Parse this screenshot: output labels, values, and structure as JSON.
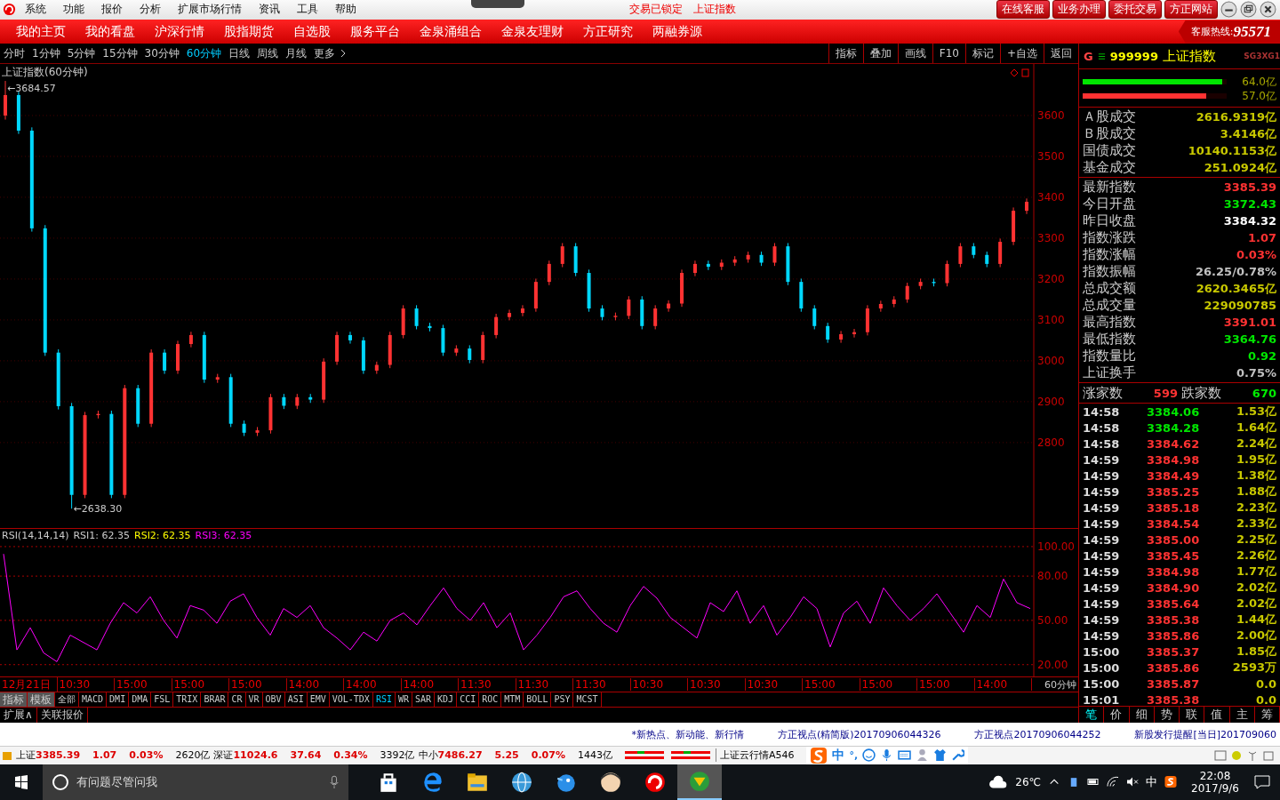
{
  "title_bar": {
    "menu": [
      "系统",
      "功能",
      "报价",
      "分析",
      "扩展市场行情",
      "资讯",
      "工具",
      "帮助"
    ],
    "status": "交易已锁定",
    "symbol": "上证指数",
    "buttons": [
      "在线客服",
      "业务办理",
      "委托交易",
      "方正网站"
    ]
  },
  "nav": {
    "items": [
      "我的主页",
      "我的看盘",
      "沪深行情",
      "股指期货",
      "自选股",
      "服务平台",
      "金泉涌组合",
      "金泉友理财",
      "方正研究",
      "两融券源"
    ],
    "hotline_label": "客服热线:",
    "hotline": "95571"
  },
  "periods": [
    {
      "label": "分时",
      "selected": false
    },
    {
      "label": "1分钟",
      "selected": false
    },
    {
      "label": "5分钟",
      "selected": false
    },
    {
      "label": "15分钟",
      "selected": false
    },
    {
      "label": "30分钟",
      "selected": false
    },
    {
      "label": "60分钟",
      "selected": true
    },
    {
      "label": "日线",
      "selected": false
    },
    {
      "label": "周线",
      "selected": false
    },
    {
      "label": "月线",
      "selected": false
    },
    {
      "label": "更多",
      "selected": false
    }
  ],
  "tools": [
    "指标",
    "叠加",
    "画线",
    "F10",
    "标记",
    "+自选",
    "返回"
  ],
  "price_chart": {
    "title": "上证指数(60分钟)",
    "chart_data": {
      "type": "candlestick",
      "grid": true,
      "ylim": [
        2591,
        3726
      ],
      "yticks": [
        2800,
        2900,
        3000,
        3100,
        3200,
        3300,
        3400,
        3500,
        3600
      ],
      "ohlc": [
        [
          3600,
          3684.57,
          3590,
          3650
        ],
        [
          3650,
          3658,
          3555,
          3563
        ],
        [
          3563,
          3571,
          3316,
          3324
        ],
        [
          3324,
          3332,
          3012,
          3020
        ],
        [
          3020,
          3028,
          2881,
          2889
        ],
        [
          2889,
          2897,
          2638.3,
          2672
        ],
        [
          2672,
          2875,
          2664,
          2867
        ],
        [
          2867,
          2878,
          2859,
          2870
        ],
        [
          2870,
          2878,
          2664,
          2672
        ],
        [
          2672,
          2941,
          2664,
          2933
        ],
        [
          2933,
          2941,
          2838,
          2846
        ],
        [
          2846,
          3028,
          2838,
          3020
        ],
        [
          3020,
          3028,
          2968,
          2976
        ],
        [
          2976,
          3049,
          2968,
          3041
        ],
        [
          3041,
          3071,
          3033,
          3063
        ],
        [
          3063,
          3071,
          2946,
          2954
        ],
        [
          2954,
          2968,
          2946,
          2960
        ],
        [
          2960,
          2968,
          2838,
          2846
        ],
        [
          2846,
          2854,
          2816,
          2824
        ],
        [
          2824,
          2838,
          2816,
          2830
        ],
        [
          2830,
          2919,
          2822,
          2911
        ],
        [
          2911,
          2919,
          2882,
          2890
        ],
        [
          2890,
          2919,
          2882,
          2911
        ],
        [
          2911,
          2919,
          2897,
          2905
        ],
        [
          2905,
          3006,
          2897,
          2998
        ],
        [
          2998,
          3071,
          2990,
          3063
        ],
        [
          3063,
          3071,
          3042,
          3050
        ],
        [
          3050,
          3058,
          2968,
          2976
        ],
        [
          2976,
          2998,
          2968,
          2990
        ],
        [
          2990,
          3071,
          2982,
          3063
        ],
        [
          3063,
          3136,
          3055,
          3128
        ],
        [
          3128,
          3136,
          3077,
          3085
        ],
        [
          3085,
          3093,
          3072,
          3080
        ],
        [
          3080,
          3088,
          3012,
          3020
        ],
        [
          3020,
          3038,
          3012,
          3030
        ],
        [
          3030,
          3038,
          2994,
          3002
        ],
        [
          3002,
          3071,
          2994,
          3063
        ],
        [
          3063,
          3115,
          3055,
          3107
        ],
        [
          3107,
          3125,
          3099,
          3117
        ],
        [
          3117,
          3136,
          3109,
          3128
        ],
        [
          3128,
          3201,
          3120,
          3193
        ],
        [
          3193,
          3245,
          3185,
          3237
        ],
        [
          3237,
          3288,
          3229,
          3280
        ],
        [
          3280,
          3288,
          3207,
          3215
        ],
        [
          3215,
          3223,
          3120,
          3128
        ],
        [
          3128,
          3136,
          3099,
          3107
        ],
        [
          3107,
          3118,
          3099,
          3110
        ],
        [
          3110,
          3158,
          3102,
          3150
        ],
        [
          3150,
          3158,
          3077,
          3085
        ],
        [
          3085,
          3136,
          3077,
          3128
        ],
        [
          3128,
          3148,
          3120,
          3140
        ],
        [
          3140,
          3223,
          3132,
          3215
        ],
        [
          3215,
          3245,
          3207,
          3237
        ],
        [
          3237,
          3245,
          3222,
          3230
        ],
        [
          3230,
          3248,
          3222,
          3240
        ],
        [
          3240,
          3256,
          3232,
          3248
        ],
        [
          3248,
          3267,
          3240,
          3259
        ],
        [
          3259,
          3267,
          3232,
          3240
        ],
        [
          3240,
          3288,
          3232,
          3280
        ],
        [
          3280,
          3288,
          3185,
          3193
        ],
        [
          3193,
          3201,
          3120,
          3128
        ],
        [
          3128,
          3136,
          3077,
          3085
        ],
        [
          3085,
          3093,
          3044,
          3052
        ],
        [
          3052,
          3073,
          3044,
          3065
        ],
        [
          3065,
          3078,
          3057,
          3070
        ],
        [
          3070,
          3136,
          3062,
          3128
        ],
        [
          3128,
          3147,
          3120,
          3139
        ],
        [
          3139,
          3158,
          3131,
          3150
        ],
        [
          3150,
          3191,
          3142,
          3183
        ],
        [
          3183,
          3201,
          3175,
          3193
        ],
        [
          3193,
          3201,
          3182,
          3190
        ],
        [
          3190,
          3245,
          3182,
          3237
        ],
        [
          3237,
          3288,
          3229,
          3280
        ],
        [
          3280,
          3288,
          3251,
          3259
        ],
        [
          3259,
          3267,
          3229,
          3237
        ],
        [
          3237,
          3299,
          3229,
          3291
        ],
        [
          3291,
          3375,
          3283,
          3367
        ],
        [
          3367,
          3397,
          3359,
          3389
        ]
      ],
      "annotations": [
        {
          "text": "←3684.57"
        },
        {
          "text": "←2638.30"
        }
      ]
    }
  },
  "rsi_chart": {
    "legend": [
      "RSI(14,14,14)",
      "RSI1: 62.35",
      "RSI2: 62.35",
      "RSI3: 62.35"
    ],
    "chart_data": {
      "type": "line",
      "grid": true,
      "ylim": [
        12,
        112
      ],
      "yticks": [
        {
          "value": 100,
          "label": "100.00"
        },
        {
          "value": 80,
          "label": "80.00"
        },
        {
          "value": 50,
          "label": "50.00"
        },
        {
          "value": 20,
          "label": "20.00"
        }
      ],
      "series": [
        {
          "color": "#ff00ff",
          "values": [
            95,
            30,
            45,
            28,
            22,
            40,
            35,
            30,
            48,
            62,
            55,
            66,
            50,
            38,
            60,
            57,
            48,
            63,
            68,
            52,
            40,
            58,
            52,
            60,
            45,
            38,
            30,
            42,
            36,
            50,
            55,
            47,
            60,
            72,
            58,
            50,
            62,
            45,
            55,
            30,
            40,
            52,
            66,
            70,
            58,
            48,
            42,
            60,
            73,
            65,
            52,
            45,
            38,
            62,
            56,
            70,
            48,
            60,
            40,
            52,
            66,
            58,
            32,
            55,
            63,
            48,
            72,
            60,
            50,
            58,
            68,
            55,
            42,
            60,
            52,
            78,
            62,
            58
          ]
        }
      ]
    }
  },
  "x_labels": [
    "12月21日",
    "10:30",
    "15:00",
    "15:00",
    "15:00",
    "14:00",
    "14:00",
    "14:00",
    "11:30",
    "11:30",
    "11:30",
    "10:30",
    "10:30",
    "10:30",
    "15:00",
    "15:00",
    "15:00",
    "14:00"
  ],
  "period_label": "60分钟",
  "indicator_tabs": [
    {
      "label": "指标",
      "selected": false,
      "kind": "tool"
    },
    {
      "label": "模板",
      "selected": false,
      "kind": "tool"
    },
    {
      "label": "全部",
      "selected": false,
      "kind": "tab"
    },
    {
      "label": "MACD",
      "selected": false,
      "kind": "tab"
    },
    {
      "label": "DMI",
      "selected": false,
      "kind": "tab"
    },
    {
      "label": "DMA",
      "selected": false,
      "kind": "tab"
    },
    {
      "label": "FSL",
      "selected": false,
      "kind": "tab"
    },
    {
      "label": "TRIX",
      "selected": false,
      "kind": "tab"
    },
    {
      "label": "BRAR",
      "selected": false,
      "kind": "tab"
    },
    {
      "label": "CR",
      "selected": false,
      "kind": "tab"
    },
    {
      "label": "VR",
      "selected": false,
      "kind": "tab"
    },
    {
      "label": "OBV",
      "selected": false,
      "kind": "tab"
    },
    {
      "label": "ASI",
      "selected": false,
      "kind": "tab"
    },
    {
      "label": "EMV",
      "selected": false,
      "kind": "tab"
    },
    {
      "label": "VOL-TDX",
      "selected": false,
      "kind": "tab"
    },
    {
      "label": "RSI",
      "selected": true,
      "kind": "tab"
    },
    {
      "label": "WR",
      "selected": false,
      "kind": "tab"
    },
    {
      "label": "SAR",
      "selected": false,
      "kind": "tab"
    },
    {
      "label": "KDJ",
      "selected": false,
      "kind": "tab"
    },
    {
      "label": "CCI",
      "selected": false,
      "kind": "tab"
    },
    {
      "label": "ROC",
      "selected": false,
      "kind": "tab"
    },
    {
      "label": "MTM",
      "selected": false,
      "kind": "tab"
    },
    {
      "label": "BOLL",
      "selected": false,
      "kind": "tab"
    },
    {
      "label": "PSY",
      "selected": false,
      "kind": "tab"
    },
    {
      "label": "MCST",
      "selected": false,
      "kind": "tab"
    }
  ],
  "bottom_tabs": [
    "扩展∧",
    "关联报价"
  ],
  "quote": {
    "market": "G",
    "code": "999999",
    "name": "上证指数",
    "extra": "SG3XG1",
    "bars": [
      {
        "level": 0.97,
        "value": "64.0亿",
        "color": "#00e600"
      },
      {
        "level": 0.86,
        "value": "57.0亿",
        "color": "#ff3232"
      }
    ],
    "volumes": [
      {
        "label": "Ａ股成交",
        "value": "2616.9319亿"
      },
      {
        "label": "Ｂ股成交",
        "value": "3.4146亿"
      },
      {
        "label": "国债成交",
        "value": "10140.1153亿"
      },
      {
        "label": "基金成交",
        "value": "251.0924亿"
      }
    ],
    "stats": [
      {
        "label": "最新指数",
        "value": "3385.39",
        "color": "#ff3232"
      },
      {
        "label": "今日开盘",
        "value": "3372.43",
        "color": "#00e600"
      },
      {
        "label": "昨日收盘",
        "value": "3384.32",
        "color": "#ffffff"
      },
      {
        "label": "指数涨跌",
        "value": "1.07",
        "color": "#ff3232"
      },
      {
        "label": "指数涨幅",
        "value": "0.03%",
        "color": "#ff3232"
      },
      {
        "label": "指数振幅",
        "value": "26.25/0.78%",
        "color": "#c0c0c0"
      },
      {
        "label": "总成交额",
        "value": "2620.3465亿",
        "color": "#c8c800"
      },
      {
        "label": "总成交量",
        "value": "229090785",
        "color": "#c8c800"
      },
      {
        "label": "最高指数",
        "value": "3391.01",
        "color": "#ff3232"
      },
      {
        "label": "最低指数",
        "value": "3364.76",
        "color": "#00e600"
      },
      {
        "label": "指数量比",
        "value": "0.92",
        "color": "#00e600"
      },
      {
        "label": "上证换手",
        "value": "0.75%",
        "color": "#c0c0c0"
      }
    ],
    "breadth": {
      "up_label": "涨家数",
      "up": "599",
      "down_label": "跌家数",
      "down": "670"
    },
    "ticks": [
      {
        "time": "14:58",
        "price": "3384.06",
        "volume": "1.53亿",
        "color": "#00e600"
      },
      {
        "time": "14:58",
        "price": "3384.28",
        "volume": "1.64亿",
        "color": "#00e600"
      },
      {
        "time": "14:58",
        "price": "3384.62",
        "volume": "2.24亿",
        "color": "#ff3232"
      },
      {
        "time": "14:59",
        "price": "3384.98",
        "volume": "1.95亿",
        "color": "#ff3232"
      },
      {
        "time": "14:59",
        "price": "3384.49",
        "volume": "1.38亿",
        "color": "#ff3232"
      },
      {
        "time": "14:59",
        "price": "3385.25",
        "volume": "1.88亿",
        "color": "#ff3232"
      },
      {
        "time": "14:59",
        "price": "3385.18",
        "volume": "2.23亿",
        "color": "#ff3232"
      },
      {
        "time": "14:59",
        "price": "3384.54",
        "volume": "2.33亿",
        "color": "#ff3232"
      },
      {
        "time": "14:59",
        "price": "3385.00",
        "volume": "2.25亿",
        "color": "#ff3232"
      },
      {
        "time": "14:59",
        "price": "3385.45",
        "volume": "2.26亿",
        "color": "#ff3232"
      },
      {
        "time": "14:59",
        "price": "3384.98",
        "volume": "1.77亿",
        "color": "#ff3232"
      },
      {
        "time": "14:59",
        "price": "3384.90",
        "volume": "2.02亿",
        "color": "#ff3232"
      },
      {
        "time": "14:59",
        "price": "3385.64",
        "volume": "2.02亿",
        "color": "#ff3232"
      },
      {
        "time": "14:59",
        "price": "3385.38",
        "volume": "1.44亿",
        "color": "#ff3232"
      },
      {
        "time": "14:59",
        "price": "3385.86",
        "volume": "2.00亿",
        "color": "#ff3232"
      },
      {
        "time": "15:00",
        "price": "3385.37",
        "volume": "1.85亿",
        "color": "#ff3232"
      },
      {
        "time": "15:00",
        "price": "3385.86",
        "volume": "2593万",
        "color": "#ff3232"
      },
      {
        "time": "15:00",
        "price": "3385.87",
        "volume": "0.0",
        "color": "#ff3232"
      },
      {
        "time": "15:01",
        "price": "3385.38",
        "volume": "0.0",
        "color": "#ff3232"
      }
    ],
    "tabs": [
      {
        "label": "笔",
        "selected": true
      },
      {
        "label": "价",
        "selected": false
      },
      {
        "label": "细",
        "selected": false
      },
      {
        "label": "势",
        "selected": false
      },
      {
        "label": "联",
        "selected": false
      },
      {
        "label": "值",
        "selected": false
      },
      {
        "label": "主",
        "selected": false
      },
      {
        "label": "筹",
        "selected": false
      }
    ]
  },
  "news": [
    "*新热点、新动能、新行情",
    "方正视点(精简版)20170906044326",
    "方正视点20170906044252",
    "新股发行提醒[当日]201709060"
  ],
  "indices": [
    {
      "name": "上证",
      "price": "3385.39",
      "change": "1.07",
      "pct": "0.03%",
      "amount": "2620亿"
    },
    {
      "name": "深证",
      "price": "11024.6",
      "change": "37.64",
      "pct": "0.34%",
      "amount": "3392亿"
    },
    {
      "name": "中小",
      "price": "7486.27",
      "change": "5.25",
      "pct": "0.07%",
      "amount": "1443亿"
    }
  ],
  "cloud_quote": "上证云行情A546",
  "ime": {
    "mode": "中",
    "punct": "°,"
  },
  "taskbar": {
    "search": "有问题尽管问我",
    "weather": "26℃",
    "ime": "中",
    "time": "22:08",
    "date": "2017/9/6"
  }
}
